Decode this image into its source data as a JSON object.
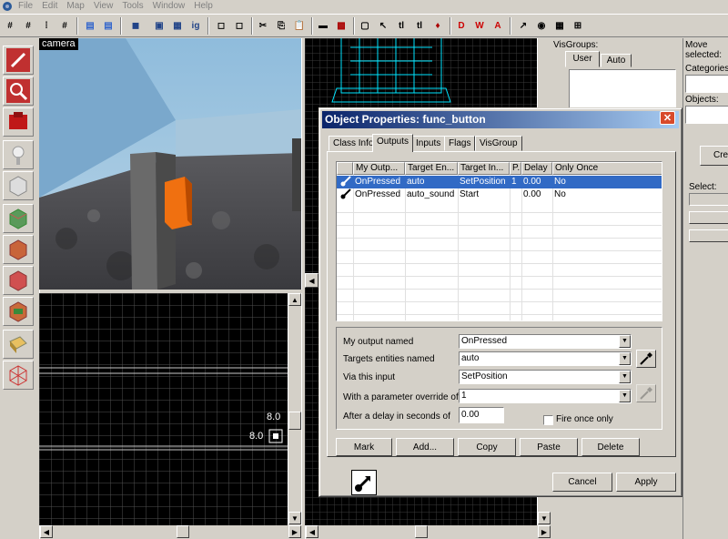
{
  "menu": [
    "File",
    "Edit",
    "Map",
    "View",
    "Tools",
    "Window",
    "Help"
  ],
  "camera": {
    "label": "camera"
  },
  "grid2d": {
    "label_x": "8.0",
    "label_y": "8.0"
  },
  "visgroups": {
    "title": "VisGroups:",
    "tabs": [
      "User",
      "Auto"
    ]
  },
  "side": {
    "move_selected": "Move selected:",
    "categories": "Categories:",
    "objects": "Objects:",
    "create": "Cre",
    "select": "Select:"
  },
  "dialog": {
    "title": "Object Properties: func_button",
    "tabs": [
      "Class Info",
      "Outputs",
      "Inputs",
      "Flags",
      "VisGroup"
    ],
    "active_tab": "Outputs",
    "table": {
      "headers": [
        "My Outp...",
        "Target En...",
        "Target In...",
        "P.",
        "Delay",
        "Only Once"
      ],
      "rows": [
        {
          "output": "OnPressed",
          "target": "auto",
          "input": "SetPosition",
          "param": "1",
          "delay": "0.00",
          "once": "No",
          "selected": true
        },
        {
          "output": "OnPressed",
          "target": "auto_sound",
          "input": "Start",
          "param": "",
          "delay": "0.00",
          "once": "No",
          "selected": false
        }
      ]
    },
    "fields": {
      "output_label": "My output named",
      "output_value": "OnPressed",
      "target_label": "Targets entities named",
      "target_value": "auto",
      "input_label": "Via this input",
      "input_value": "SetPosition",
      "param_label": "With a parameter override of",
      "param_value": "1",
      "delay_label": "After a delay in seconds of",
      "delay_value": "0.00",
      "fire_once_label": "Fire once only"
    },
    "buttons": {
      "mark": "Mark",
      "add": "Add...",
      "copy": "Copy",
      "paste": "Paste",
      "delete": "Delete",
      "cancel": "Cancel",
      "apply": "Apply"
    }
  },
  "colors": {
    "title_start": "#0a246a",
    "title_end": "#a6caf0",
    "selection": "#316ac5",
    "wire": "#00e5ff"
  }
}
